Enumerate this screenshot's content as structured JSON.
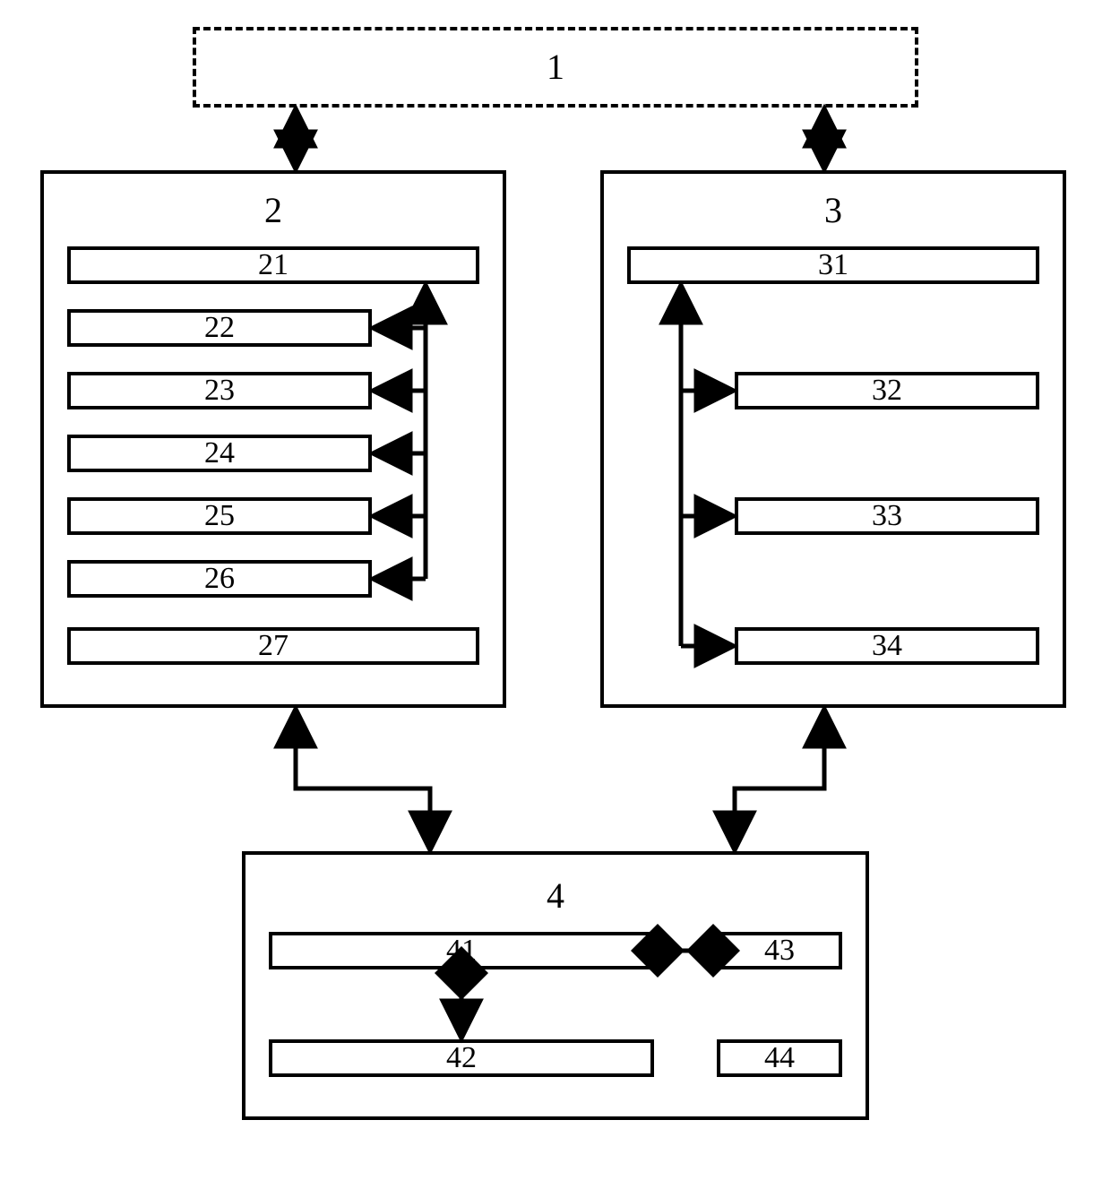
{
  "blocks": {
    "top": {
      "id": "1"
    },
    "left": {
      "id": "2",
      "items": [
        "21",
        "22",
        "23",
        "24",
        "25",
        "26",
        "27"
      ]
    },
    "right": {
      "id": "3",
      "items": [
        "31",
        "32",
        "33",
        "34"
      ]
    },
    "bottom": {
      "id": "4",
      "items": [
        "41",
        "42",
        "43",
        "44"
      ]
    }
  },
  "chart_data": {
    "type": "diagram",
    "title": "",
    "nodes": [
      {
        "id": "1",
        "parent": null
      },
      {
        "id": "2",
        "parent": null
      },
      {
        "id": "3",
        "parent": null
      },
      {
        "id": "4",
        "parent": null
      },
      {
        "id": "21",
        "parent": "2"
      },
      {
        "id": "22",
        "parent": "2"
      },
      {
        "id": "23",
        "parent": "2"
      },
      {
        "id": "24",
        "parent": "2"
      },
      {
        "id": "25",
        "parent": "2"
      },
      {
        "id": "26",
        "parent": "2"
      },
      {
        "id": "27",
        "parent": "2"
      },
      {
        "id": "31",
        "parent": "3"
      },
      {
        "id": "32",
        "parent": "3"
      },
      {
        "id": "33",
        "parent": "3"
      },
      {
        "id": "34",
        "parent": "3"
      },
      {
        "id": "41",
        "parent": "4"
      },
      {
        "id": "42",
        "parent": "4"
      },
      {
        "id": "43",
        "parent": "4"
      },
      {
        "id": "44",
        "parent": "4"
      }
    ],
    "edges": [
      {
        "from": "1",
        "to": "2",
        "dir": "both"
      },
      {
        "from": "1",
        "to": "3",
        "dir": "both"
      },
      {
        "from": "2",
        "to": "4",
        "dir": "both"
      },
      {
        "from": "3",
        "to": "4",
        "dir": "both"
      },
      {
        "from": "21",
        "to": "22",
        "dir": "to"
      },
      {
        "from": "21",
        "to": "23",
        "dir": "to"
      },
      {
        "from": "21",
        "to": "24",
        "dir": "to"
      },
      {
        "from": "21",
        "to": "25",
        "dir": "to"
      },
      {
        "from": "21",
        "to": "26",
        "dir": "to"
      },
      {
        "from": "31",
        "to": "32",
        "dir": "to"
      },
      {
        "from": "31",
        "to": "33",
        "dir": "to"
      },
      {
        "from": "31",
        "to": "34",
        "dir": "to"
      },
      {
        "from": "41",
        "to": "42",
        "dir": "both"
      },
      {
        "from": "41",
        "to": "43",
        "dir": "both"
      }
    ]
  }
}
